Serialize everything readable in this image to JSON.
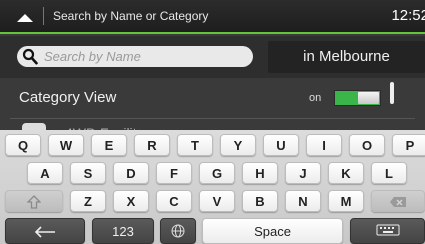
{
  "header": {
    "title": "Search by Name or Category",
    "time": "12:52"
  },
  "search": {
    "placeholder": "Search by Name",
    "value": "",
    "location_label": "in Melbourne"
  },
  "list": {
    "category_view_label": "Category View",
    "toggle_state_label": "on",
    "toggle_on": true,
    "partial_item_label": "4WD Facilit"
  },
  "keyboard": {
    "row1": [
      "Q",
      "W",
      "E",
      "R",
      "T",
      "Y",
      "U",
      "I",
      "O",
      "P"
    ],
    "row2": [
      "A",
      "S",
      "D",
      "F",
      "G",
      "H",
      "J",
      "K",
      "L"
    ],
    "row3": [
      "Z",
      "X",
      "C",
      "V",
      "B",
      "N",
      "M"
    ],
    "numbers_label": "123",
    "space_label": "Space",
    "icons": {
      "shift": "shift-arrow-icon",
      "backspace": "backspace-icon",
      "back": "left-arrow-icon",
      "globe": "globe-icon",
      "hide": "keyboard-hide-icon"
    }
  },
  "colors": {
    "accent": "#62c43b",
    "toggle_on": "#39b54a"
  }
}
